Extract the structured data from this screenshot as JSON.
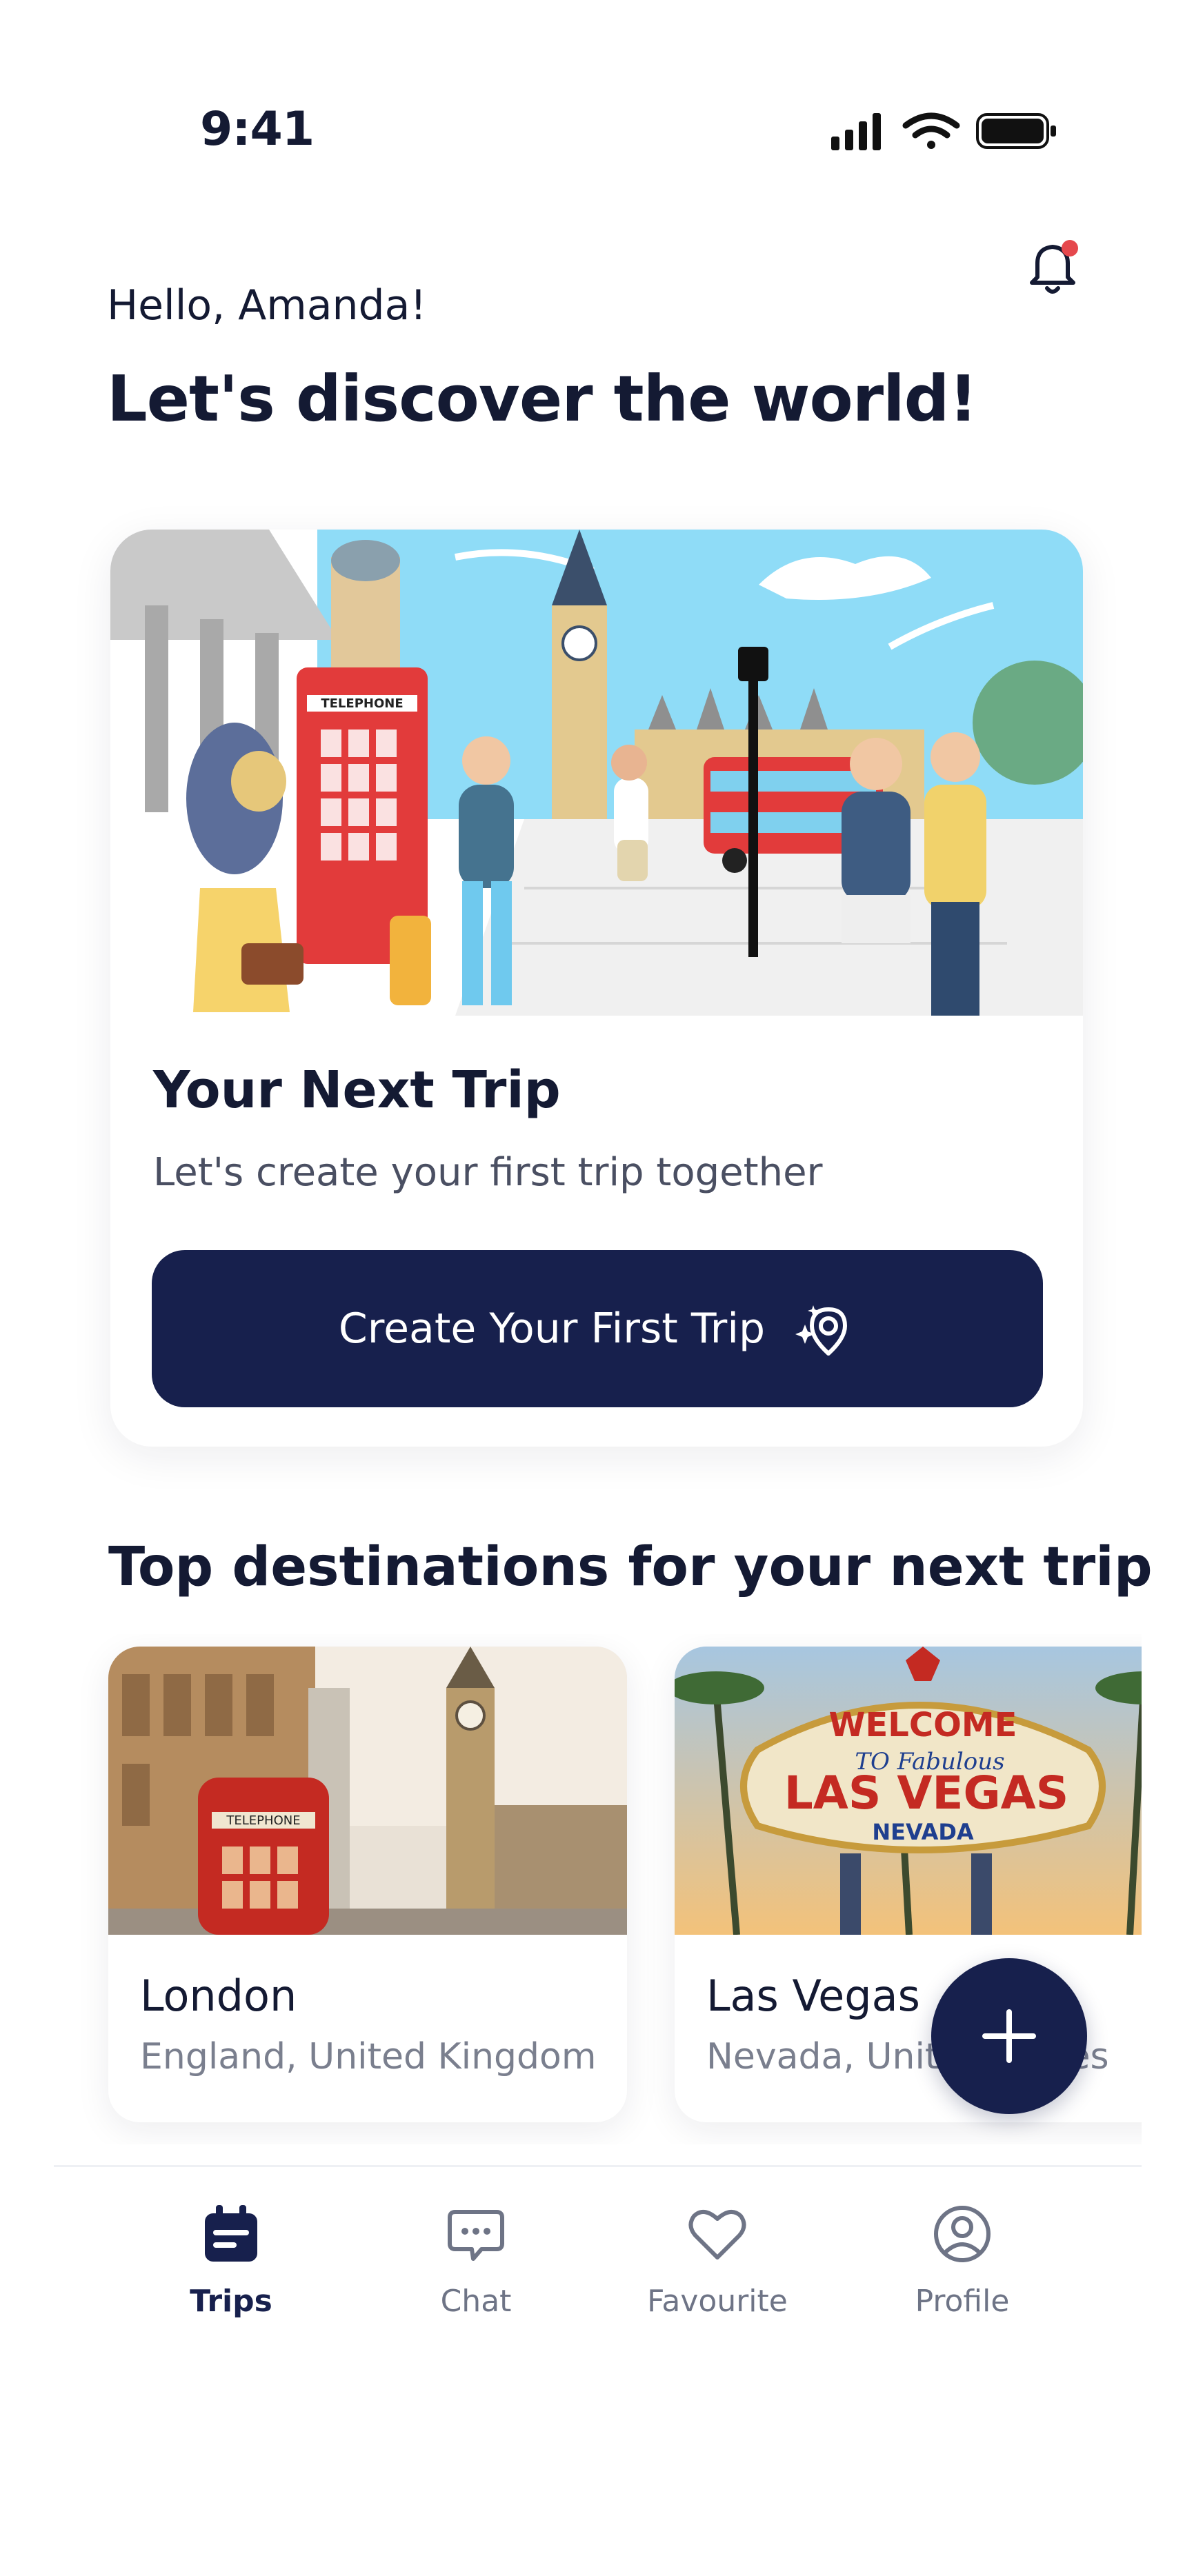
{
  "status_bar": {
    "time": "9:41"
  },
  "header": {
    "greeting": "Hello, Amanda!",
    "title": "Let's discover the world!"
  },
  "next_trip": {
    "title": "Your Next Trip",
    "subtitle": "Let's create your first trip together",
    "button_label": "Create Your First Trip",
    "hero_sign_text": "TELEPHONE"
  },
  "destinations": {
    "section_title": "Top destinations for your next trip",
    "items": [
      {
        "name": "London",
        "location": "England, United Kingdom",
        "sign_text": "TELEPHONE"
      },
      {
        "name": "Las Vegas",
        "location": "Nevada, United States",
        "sign_lines": [
          "WELCOME",
          "TO Fabulous",
          "LAS VEGAS",
          "NEVADA"
        ]
      }
    ]
  },
  "tabs": [
    {
      "label": "Trips",
      "icon": "calendar-icon",
      "active": true
    },
    {
      "label": "Chat",
      "icon": "chat-icon",
      "active": false
    },
    {
      "label": "Favourite",
      "icon": "heart-icon",
      "active": false
    },
    {
      "label": "Profile",
      "icon": "profile-icon",
      "active": false
    }
  ],
  "colors": {
    "primary": "#17204d",
    "notification_dot": "#e5484d",
    "muted_text": "#7a7f8e"
  }
}
